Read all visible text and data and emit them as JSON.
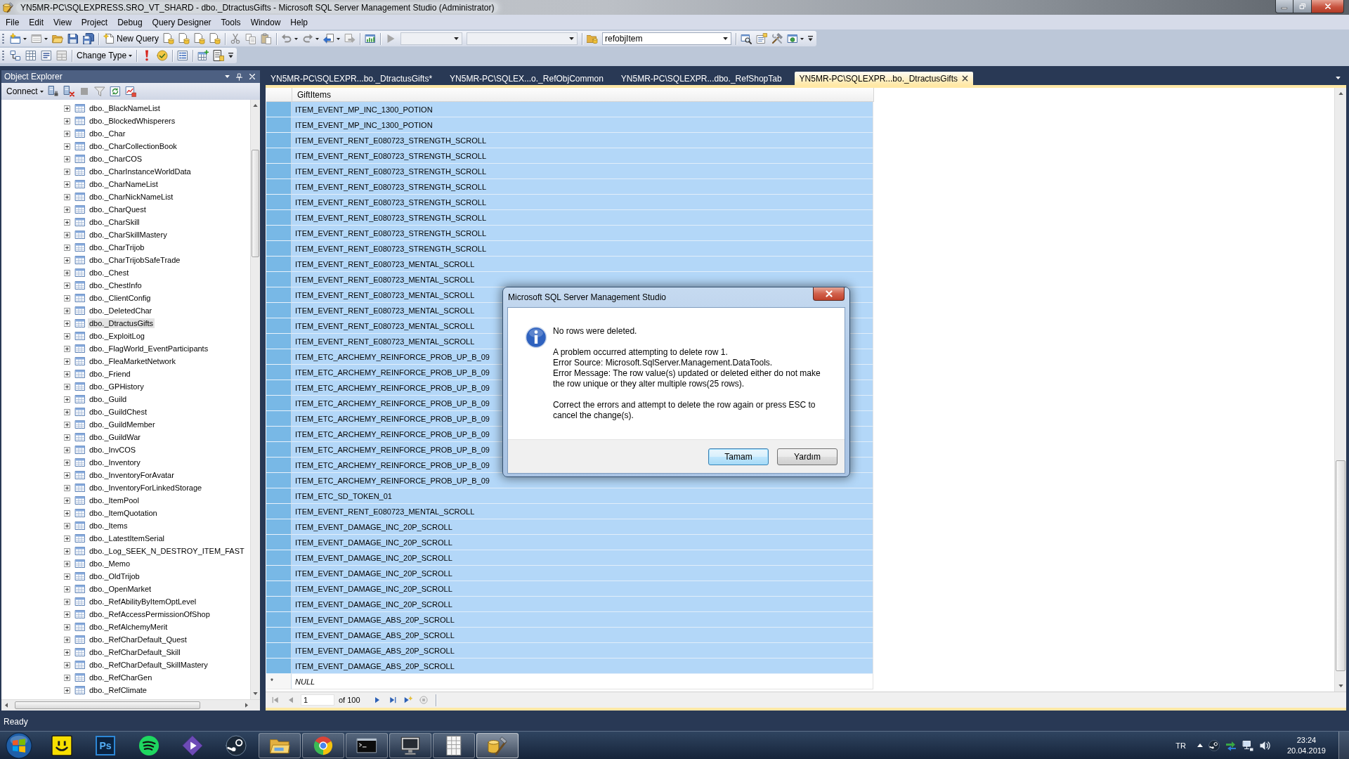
{
  "window": {
    "title": "YN5MR-PC\\SQLEXPRESS.SRO_VT_SHARD - dbo._DtractusGifts - Microsoft SQL Server Management Studio (Administrator)"
  },
  "menu": [
    "File",
    "Edit",
    "View",
    "Project",
    "Debug",
    "Query Designer",
    "Tools",
    "Window",
    "Help"
  ],
  "toolbar": {
    "new_query": "New Query",
    "database": "refobjItem",
    "change_type": "Change Type"
  },
  "object_explorer": {
    "title": "Object Explorer",
    "connect": "Connect",
    "items": [
      {
        "name": "dbo._BlackNameList",
        "selected": false,
        "expanded": false
      },
      {
        "name": "dbo._BlockedWhisperers",
        "selected": false,
        "expanded": false
      },
      {
        "name": "dbo._Char",
        "selected": false,
        "expanded": false
      },
      {
        "name": "dbo._CharCollectionBook",
        "selected": false,
        "expanded": false
      },
      {
        "name": "dbo._CharCOS",
        "selected": false,
        "expanded": false
      },
      {
        "name": "dbo._CharInstanceWorldData",
        "selected": false,
        "expanded": false
      },
      {
        "name": "dbo._CharNameList",
        "selected": false,
        "expanded": false
      },
      {
        "name": "dbo._CharNickNameList",
        "selected": false,
        "expanded": false
      },
      {
        "name": "dbo._CharQuest",
        "selected": false,
        "expanded": false
      },
      {
        "name": "dbo._CharSkill",
        "selected": false,
        "expanded": false
      },
      {
        "name": "dbo._CharSkillMastery",
        "selected": false,
        "expanded": false
      },
      {
        "name": "dbo._CharTrijob",
        "selected": false,
        "expanded": false
      },
      {
        "name": "dbo._CharTrijobSafeTrade",
        "selected": false,
        "expanded": false
      },
      {
        "name": "dbo._Chest",
        "selected": false,
        "expanded": false
      },
      {
        "name": "dbo._ChestInfo",
        "selected": false,
        "expanded": false
      },
      {
        "name": "dbo._ClientConfig",
        "selected": false,
        "expanded": false
      },
      {
        "name": "dbo._DeletedChar",
        "selected": false,
        "expanded": false
      },
      {
        "name": "dbo._DtractusGifts",
        "selected": true,
        "expanded": false
      },
      {
        "name": "dbo._ExploitLog",
        "selected": false,
        "expanded": false
      },
      {
        "name": "dbo._FlagWorld_EventParticipants",
        "selected": false,
        "expanded": false
      },
      {
        "name": "dbo._FleaMarketNetwork",
        "selected": false,
        "expanded": false
      },
      {
        "name": "dbo._Friend",
        "selected": false,
        "expanded": false
      },
      {
        "name": "dbo._GPHistory",
        "selected": false,
        "expanded": false
      },
      {
        "name": "dbo._Guild",
        "selected": false,
        "expanded": false
      },
      {
        "name": "dbo._GuildChest",
        "selected": false,
        "expanded": false
      },
      {
        "name": "dbo._GuildMember",
        "selected": false,
        "expanded": false
      },
      {
        "name": "dbo._GuildWar",
        "selected": false,
        "expanded": false
      },
      {
        "name": "dbo._InvCOS",
        "selected": false,
        "expanded": false
      },
      {
        "name": "dbo._Inventory",
        "selected": false,
        "expanded": false
      },
      {
        "name": "dbo._InventoryForAvatar",
        "selected": false,
        "expanded": false
      },
      {
        "name": "dbo._InventoryForLinkedStorage",
        "selected": false,
        "expanded": false
      },
      {
        "name": "dbo._ItemPool",
        "selected": false,
        "expanded": false
      },
      {
        "name": "dbo._ItemQuotation",
        "selected": false,
        "expanded": false
      },
      {
        "name": "dbo._Items",
        "selected": false,
        "expanded": false
      },
      {
        "name": "dbo._LatestItemSerial",
        "selected": false,
        "expanded": false
      },
      {
        "name": "dbo._Log_SEEK_N_DESTROY_ITEM_FAST",
        "selected": false,
        "expanded": false
      },
      {
        "name": "dbo._Memo",
        "selected": false,
        "expanded": false
      },
      {
        "name": "dbo._OldTrijob",
        "selected": false,
        "expanded": false
      },
      {
        "name": "dbo._OpenMarket",
        "selected": false,
        "expanded": false
      },
      {
        "name": "dbo._RefAbilityByItemOptLevel",
        "selected": false,
        "expanded": false
      },
      {
        "name": "dbo._RefAccessPermissionOfShop",
        "selected": false,
        "expanded": false
      },
      {
        "name": "dbo._RefAlchemyMerit",
        "selected": false,
        "expanded": false
      },
      {
        "name": "dbo._RefCharDefault_Quest",
        "selected": false,
        "expanded": false
      },
      {
        "name": "dbo._RefCharDefault_Skill",
        "selected": false,
        "expanded": false
      },
      {
        "name": "dbo._RefCharDefault_SkillMastery",
        "selected": false,
        "expanded": false
      },
      {
        "name": "dbo._RefCharGen",
        "selected": false,
        "expanded": false
      },
      {
        "name": "dbo._RefClimate",
        "selected": false,
        "expanded": false
      }
    ]
  },
  "tabs": [
    {
      "label": "YN5MR-PC\\SQLEXPR...bo._DtractusGifts*",
      "selected": false
    },
    {
      "label": "YN5MR-PC\\SQLEX...o._RefObjCommon",
      "selected": false
    },
    {
      "label": "YN5MR-PC\\SQLEXPR...dbo._RefShopTab",
      "selected": false
    },
    {
      "label": "YN5MR-PC\\SQLEXPR...bo._DtractusGifts",
      "selected": true
    }
  ],
  "grid": {
    "column": "GiftItems",
    "rows": [
      {
        "value": "ITEM_EVENT_MP_INC_1300_POTION",
        "selected": true
      },
      {
        "value": "ITEM_EVENT_MP_INC_1300_POTION",
        "selected": true
      },
      {
        "value": "ITEM_EVENT_RENT_E080723_STRENGTH_SCROLL",
        "selected": true
      },
      {
        "value": "ITEM_EVENT_RENT_E080723_STRENGTH_SCROLL",
        "selected": true
      },
      {
        "value": "ITEM_EVENT_RENT_E080723_STRENGTH_SCROLL",
        "selected": true
      },
      {
        "value": "ITEM_EVENT_RENT_E080723_STRENGTH_SCROLL",
        "selected": true
      },
      {
        "value": "ITEM_EVENT_RENT_E080723_STRENGTH_SCROLL",
        "selected": true
      },
      {
        "value": "ITEM_EVENT_RENT_E080723_STRENGTH_SCROLL",
        "selected": true
      },
      {
        "value": "ITEM_EVENT_RENT_E080723_STRENGTH_SCROLL",
        "selected": true
      },
      {
        "value": "ITEM_EVENT_RENT_E080723_STRENGTH_SCROLL",
        "selected": true
      },
      {
        "value": "ITEM_EVENT_RENT_E080723_MENTAL_SCROLL",
        "selected": true
      },
      {
        "value": "ITEM_EVENT_RENT_E080723_MENTAL_SCROLL",
        "selected": true
      },
      {
        "value": "ITEM_EVENT_RENT_E080723_MENTAL_SCROLL",
        "selected": true
      },
      {
        "value": "ITEM_EVENT_RENT_E080723_MENTAL_SCROLL",
        "selected": true
      },
      {
        "value": "ITEM_EVENT_RENT_E080723_MENTAL_SCROLL",
        "selected": true
      },
      {
        "value": "ITEM_EVENT_RENT_E080723_MENTAL_SCROLL",
        "selected": true
      },
      {
        "value": "ITEM_ETC_ARCHEMY_REINFORCE_PROB_UP_B_09",
        "selected": true
      },
      {
        "value": "ITEM_ETC_ARCHEMY_REINFORCE_PROB_UP_B_09",
        "selected": true
      },
      {
        "value": "ITEM_ETC_ARCHEMY_REINFORCE_PROB_UP_B_09",
        "selected": true
      },
      {
        "value": "ITEM_ETC_ARCHEMY_REINFORCE_PROB_UP_B_09",
        "selected": true
      },
      {
        "value": "ITEM_ETC_ARCHEMY_REINFORCE_PROB_UP_B_09",
        "selected": true
      },
      {
        "value": "ITEM_ETC_ARCHEMY_REINFORCE_PROB_UP_B_09",
        "selected": true
      },
      {
        "value": "ITEM_ETC_ARCHEMY_REINFORCE_PROB_UP_B_09",
        "selected": true
      },
      {
        "value": "ITEM_ETC_ARCHEMY_REINFORCE_PROB_UP_B_09",
        "selected": true
      },
      {
        "value": "ITEM_ETC_ARCHEMY_REINFORCE_PROB_UP_B_09",
        "selected": true
      },
      {
        "value": "ITEM_ETC_SD_TOKEN_01",
        "selected": true
      },
      {
        "value": "ITEM_EVENT_RENT_E080723_MENTAL_SCROLL",
        "selected": true
      },
      {
        "value": "ITEM_EVENT_DAMAGE_INC_20P_SCROLL",
        "selected": true
      },
      {
        "value": "ITEM_EVENT_DAMAGE_INC_20P_SCROLL",
        "selected": true
      },
      {
        "value": "ITEM_EVENT_DAMAGE_INC_20P_SCROLL",
        "selected": true
      },
      {
        "value": "ITEM_EVENT_DAMAGE_INC_20P_SCROLL",
        "selected": true
      },
      {
        "value": "ITEM_EVENT_DAMAGE_INC_20P_SCROLL",
        "selected": true
      },
      {
        "value": "ITEM_EVENT_DAMAGE_INC_20P_SCROLL",
        "selected": true
      },
      {
        "value": "ITEM_EVENT_DAMAGE_ABS_20P_SCROLL",
        "selected": true
      },
      {
        "value": "ITEM_EVENT_DAMAGE_ABS_20P_SCROLL",
        "selected": true
      },
      {
        "value": "ITEM_EVENT_DAMAGE_ABS_20P_SCROLL",
        "selected": true
      },
      {
        "value": "ITEM_EVENT_DAMAGE_ABS_20P_SCROLL",
        "selected": true
      }
    ],
    "new_row": {
      "marker": "*",
      "value": "NULL"
    },
    "navigation": {
      "page": "1",
      "page_count": "of 100"
    }
  },
  "dialog": {
    "title": "Microsoft SQL Server Management Studio",
    "message": [
      [
        "No rows were deleted."
      ],
      [
        "A problem occurred attempting to delete row 1.",
        "Error Source: Microsoft.SqlServer.Management.DataTools.",
        "Error Message: The row value(s) updated or deleted either do not make the row unique or they alter multiple rows(25 rows)."
      ],
      [
        "Correct the errors and attempt to delete the row again or press ESC to cancel the change(s)."
      ]
    ],
    "buttons": [
      {
        "label": "Tamam",
        "default": true
      },
      {
        "label": "Yardım",
        "default": false
      }
    ]
  },
  "status_bar": {
    "text": "Ready"
  },
  "taskbar": {
    "apps": [
      {
        "kind": "smiley",
        "running": false,
        "selected": false
      },
      {
        "kind": "ps",
        "label": "Ps",
        "running": false,
        "selected": false
      },
      {
        "kind": "green-circle",
        "running": false,
        "selected": false
      },
      {
        "kind": "diamond",
        "running": false,
        "selected": false
      },
      {
        "kind": "piston",
        "running": false,
        "selected": false
      },
      {
        "kind": "folder",
        "running": true,
        "selected": false
      },
      {
        "kind": "color-wheel",
        "running": true,
        "selected": false
      },
      {
        "kind": "terminal",
        "running": true,
        "selected": false
      },
      {
        "kind": "monitor",
        "running": true,
        "selected": false
      },
      {
        "kind": "sheet",
        "running": true,
        "selected": false
      },
      {
        "kind": "tools",
        "running": true,
        "selected": true
      }
    ],
    "language": "TR",
    "clock": {
      "time": "23:24",
      "date": "20.04.2019"
    }
  }
}
